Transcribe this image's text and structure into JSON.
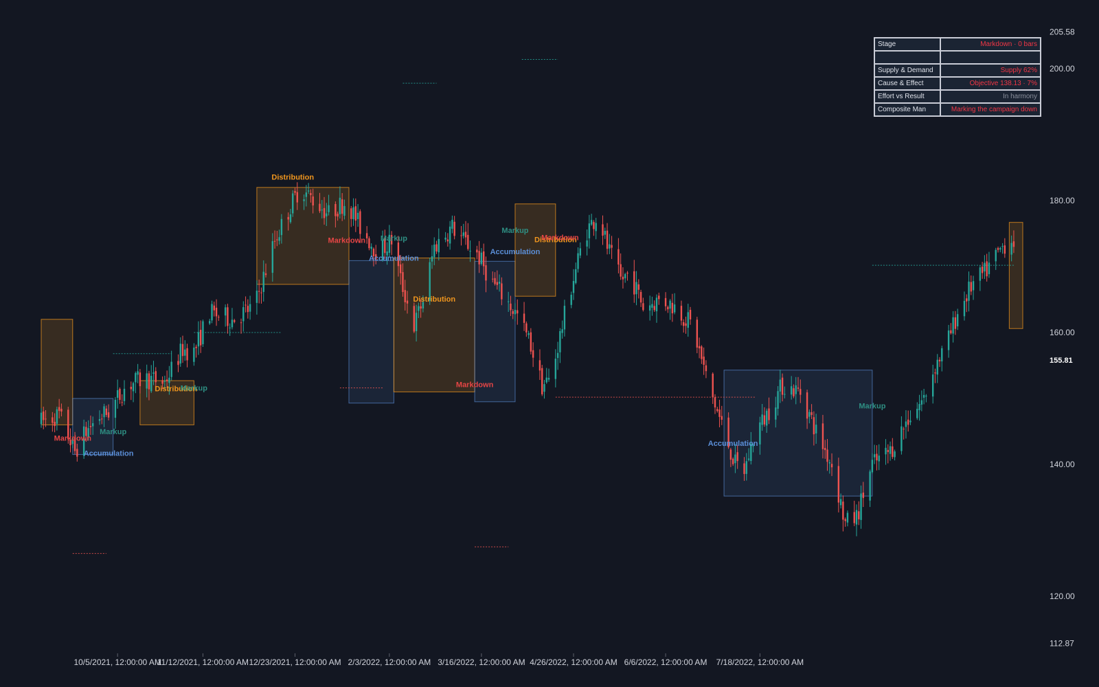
{
  "chart_data": {
    "type": "candlestick",
    "x_dates": [
      "2021-09-01",
      "2022-08-31"
    ],
    "x_ticks": [
      "10/5/2021, 12:00:00 AM",
      "11/12/2021, 12:00:00 AM",
      "12/23/2021, 12:00:00 AM",
      "2/3/2022, 12:00:00 AM",
      "3/16/2022, 12:00:00 AM",
      "4/26/2022, 12:00:00 AM",
      "6/6/2022, 12:00:00 AM",
      "7/18/2022, 12:00:00 AM"
    ],
    "y_ticks": [
      "205.58",
      "200.00",
      "180.00",
      "160.00",
      "140.00",
      "120.00",
      "112.87"
    ],
    "y_range": [
      112.87,
      205.58
    ],
    "last_price": "155.81",
    "colors": {
      "up": "#26a69a",
      "down": "#ef5350",
      "accumulation": "#5b8fd8",
      "distribution": "#f0961e",
      "markup": "#2e8f83",
      "markdown": "#e64545",
      "background": "#131722"
    },
    "path_nodes": [
      [
        0,
        146.5
      ],
      [
        8,
        147.5
      ],
      [
        15,
        142
      ],
      [
        20,
        145
      ],
      [
        25,
        147
      ],
      [
        30,
        148
      ],
      [
        38,
        152
      ],
      [
        46,
        153
      ],
      [
        55,
        152.5
      ],
      [
        63,
        157.5
      ],
      [
        68,
        157
      ],
      [
        75,
        163
      ],
      [
        85,
        162
      ],
      [
        95,
        164
      ],
      [
        104,
        174
      ],
      [
        115,
        182
      ],
      [
        128,
        178
      ],
      [
        136,
        180
      ],
      [
        142,
        176
      ],
      [
        150,
        172
      ],
      [
        156,
        174
      ],
      [
        160,
        168
      ],
      [
        166,
        161
      ],
      [
        170,
        165
      ],
      [
        175,
        173
      ],
      [
        183,
        176
      ],
      [
        188,
        174
      ],
      [
        194,
        172
      ],
      [
        200,
        168
      ],
      [
        207,
        165
      ],
      [
        213,
        162
      ],
      [
        218,
        158
      ],
      [
        223,
        152
      ],
      [
        227,
        153
      ],
      [
        230,
        158
      ],
      [
        236,
        167
      ],
      [
        242,
        175
      ],
      [
        248,
        178
      ],
      [
        252,
        173
      ],
      [
        258,
        168
      ],
      [
        262,
        169
      ],
      [
        268,
        164
      ],
      [
        276,
        165
      ],
      [
        282,
        164
      ],
      [
        290,
        161
      ],
      [
        297,
        152
      ],
      [
        302,
        147
      ],
      [
        309,
        140
      ],
      [
        313,
        139
      ],
      [
        318,
        145
      ],
      [
        322,
        147
      ],
      [
        330,
        152
      ],
      [
        338,
        151
      ],
      [
        345,
        145
      ],
      [
        352,
        140
      ],
      [
        358,
        131
      ],
      [
        363,
        132
      ],
      [
        370,
        140
      ],
      [
        378,
        142
      ],
      [
        386,
        147
      ],
      [
        393,
        150
      ],
      [
        398,
        155
      ],
      [
        403,
        158
      ],
      [
        408,
        163
      ],
      [
        414,
        167
      ],
      [
        420,
        169
      ],
      [
        426,
        172
      ],
      [
        430,
        174
      ],
      [
        433,
        174
      ]
    ],
    "zones": [
      {
        "kind": "distribution",
        "day_start": 0,
        "day_end": 14,
        "low": 146,
        "high": 162
      },
      {
        "kind": "accumulation",
        "day_start": 14,
        "day_end": 32,
        "low": 141.5,
        "high": 150
      },
      {
        "kind": "distribution",
        "day_start": 44,
        "day_end": 68,
        "low": 146,
        "high": 152.7
      },
      {
        "kind": "distribution",
        "day_start": 96,
        "day_end": 137,
        "low": 167.3,
        "high": 182
      },
      {
        "kind": "accumulation",
        "day_start": 137,
        "day_end": 157,
        "low": 149.3,
        "high": 170.9
      },
      {
        "kind": "distribution",
        "day_start": 157,
        "day_end": 193,
        "low": 151,
        "high": 171.3
      },
      {
        "kind": "accumulation",
        "day_start": 193,
        "day_end": 211,
        "low": 149.5,
        "high": 170.8
      },
      {
        "kind": "distribution",
        "day_start": 211,
        "day_end": 229,
        "low": 165.5,
        "high": 179.5
      },
      {
        "kind": "accumulation",
        "day_start": 304,
        "day_end": 370,
        "low": 135.2,
        "high": 154.3
      },
      {
        "kind": "distribution",
        "day_start": 431,
        "day_end": 437,
        "low": 160.6,
        "high": 176.7
      }
    ],
    "labels": [
      {
        "text": "Markdown",
        "kind": "markdown",
        "day": 14,
        "price": 143.6
      },
      {
        "text": "Markup",
        "kind": "markup",
        "day": 32,
        "price": 144.6
      },
      {
        "text": "Accumulation",
        "kind": "accumulation",
        "day": 30,
        "price": 141.3
      },
      {
        "text": "Distribution",
        "kind": "distribution",
        "day": 60,
        "price": 151.1
      },
      {
        "text": "Markup",
        "kind": "markup",
        "day": 68,
        "price": 151.2
      },
      {
        "text": "Distribution",
        "kind": "distribution",
        "day": 112,
        "price": 183.2
      },
      {
        "text": "Markdown",
        "kind": "markdown",
        "day": 136,
        "price": 173.6
      },
      {
        "text": "Accumulation",
        "kind": "accumulation",
        "day": 157,
        "price": 170.9
      },
      {
        "text": "Markup",
        "kind": "markup",
        "day": 157,
        "price": 173.9
      },
      {
        "text": "Distribution",
        "kind": "distribution",
        "day": 175,
        "price": 164.7
      },
      {
        "text": "Markdown",
        "kind": "markdown",
        "day": 193,
        "price": 151.7
      },
      {
        "text": "Accumulation",
        "kind": "accumulation",
        "day": 211,
        "price": 171.9
      },
      {
        "text": "Markup",
        "kind": "markup",
        "day": 211,
        "price": 175.1
      },
      {
        "text": "Distribution",
        "kind": "distribution",
        "day": 229,
        "price": 173.7
      },
      {
        "text": "Markdown",
        "kind": "markdown",
        "day": 231,
        "price": 174.0
      },
      {
        "text": "Accumulation",
        "kind": "accumulation",
        "day": 308,
        "price": 142.8
      },
      {
        "text": "Markup",
        "kind": "markup",
        "day": 370,
        "price": 148.5
      }
    ],
    "levels": [
      {
        "kind": "resistance",
        "day_start": 32,
        "day_end": 58,
        "price": 156.8
      },
      {
        "kind": "support",
        "day_start": 14,
        "day_end": 29,
        "price": 126.5
      },
      {
        "kind": "resistance",
        "day_start": 68,
        "day_end": 107,
        "price": 160.0
      },
      {
        "kind": "resistance",
        "day_start": 161,
        "day_end": 176,
        "price": 197.8
      },
      {
        "kind": "support",
        "day_start": 133,
        "day_end": 152,
        "price": 151.6
      },
      {
        "kind": "resistance",
        "day_start": 214,
        "day_end": 230,
        "price": 201.4
      },
      {
        "kind": "support",
        "day_start": 193,
        "day_end": 208,
        "price": 127.5
      },
      {
        "kind": "support",
        "day_start": 229,
        "day_end": 318,
        "price": 150.2
      },
      {
        "kind": "resistance",
        "day_start": 370,
        "day_end": 433,
        "price": 170.2
      }
    ]
  },
  "status_table": {
    "rows": [
      {
        "key": "Stage",
        "value": "Markdown · 0 bars",
        "color": "#f23645"
      },
      {
        "key": "",
        "value": "",
        "color": "#e0e3eb"
      },
      {
        "key": "Supply & Demand",
        "value": "Supply 62%",
        "color": "#f23645"
      },
      {
        "key": "Cause & Effect",
        "value": "Objective 138.13 · 7%",
        "color": "#f23645"
      },
      {
        "key": "Effort vs Result",
        "value": "In harmony",
        "color": "#8a8f9c"
      },
      {
        "key": "Composite Man",
        "value": "Marking the campaign down",
        "color": "#f23645"
      }
    ]
  }
}
